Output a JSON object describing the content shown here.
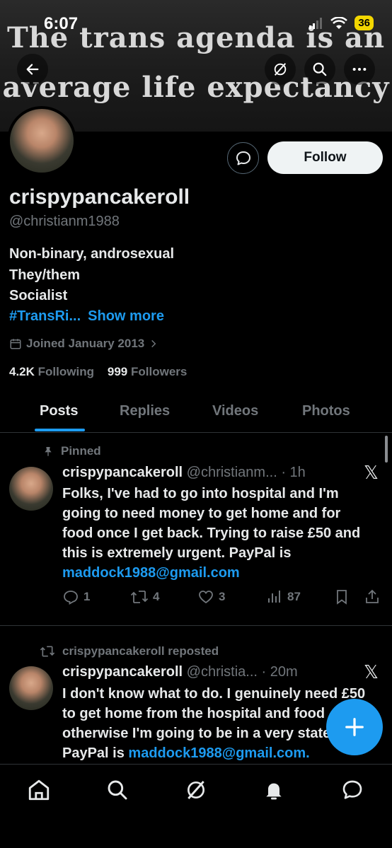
{
  "status": {
    "time": "6:07",
    "battery": "36"
  },
  "banner": {
    "line1": "The trans agenda is an",
    "line2": "average life expectancy"
  },
  "icons": {
    "back": "arrow-left-icon",
    "grok": "grok-icon",
    "search": "search-icon",
    "more": "more-icon",
    "message": "message-icon",
    "pin": "pin-icon",
    "repost": "repost-icon",
    "compose": "plus-icon"
  },
  "profile": {
    "display_name": "crispypancakeroll",
    "handle": "@christianm1988",
    "follow_label": "Follow",
    "bio": {
      "line1": "Non-binary, androsexual",
      "line2": "They/them",
      "line3": "Socialist",
      "hashtag": "#TransRi...",
      "show_more": "Show more"
    },
    "joined": "Joined January 2013",
    "following_count": "4.2K",
    "following_label": "Following",
    "followers_count": "999",
    "followers_label": "Followers"
  },
  "tabs": [
    "Posts",
    "Replies",
    "Videos",
    "Photos"
  ],
  "posts": [
    {
      "context": "Pinned",
      "name": "crispypancakeroll",
      "meta": "@christianm... · 1h",
      "text": "Folks, I've had to go into hospital and I'm going to need money to get home and for food once I get back. Trying to raise £50 and this is extremely urgent. PayPal is",
      "link": "maddock1988@gmail.com",
      "replies": "1",
      "reposts": "4",
      "likes": "3",
      "views": "87"
    },
    {
      "context": "crispypancakeroll reposted",
      "name": "crispypancakeroll",
      "meta": "@christia... · 20m",
      "text": "I don't know what to do. I genuinely need £50 to get home from the hospital and food otherwise I'm going to be in a very state. PayPal is",
      "link": "maddock1988@gmail.com."
    }
  ],
  "colors": {
    "accent": "#1d9bf0",
    "muted": "#71767b",
    "text": "#e7e9ea",
    "background": "#000000"
  }
}
